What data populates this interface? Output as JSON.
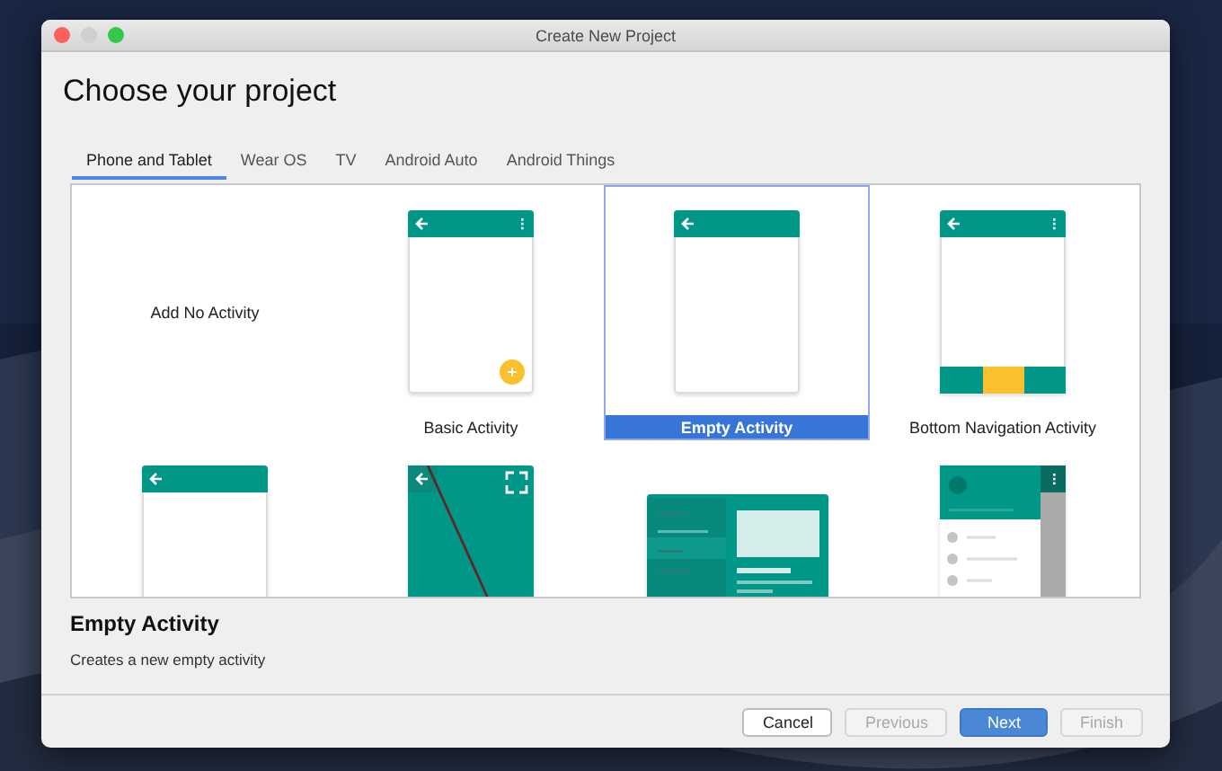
{
  "window": {
    "title": "Create New Project"
  },
  "heading": "Choose your project",
  "tabs": [
    {
      "label": "Phone and Tablet",
      "selected": true
    },
    {
      "label": "Wear OS",
      "selected": false
    },
    {
      "label": "TV",
      "selected": false
    },
    {
      "label": "Android Auto",
      "selected": false
    },
    {
      "label": "Android Things",
      "selected": false
    }
  ],
  "templates": [
    {
      "kind": "none",
      "label": "Add No Activity",
      "selected": false
    },
    {
      "kind": "basic",
      "label": "Basic Activity",
      "selected": false
    },
    {
      "kind": "empty",
      "label": "Empty Activity",
      "selected": true
    },
    {
      "kind": "bottom_nav",
      "label": "Bottom Navigation Activity",
      "selected": false
    },
    {
      "kind": "plain",
      "selected": false
    },
    {
      "kind": "fullscreen",
      "selected": false
    },
    {
      "kind": "master_detail",
      "selected": false
    },
    {
      "kind": "nav_drawer",
      "selected": false
    }
  ],
  "description": {
    "title": "Empty Activity",
    "text": "Creates a new empty activity"
  },
  "buttons": [
    {
      "label": "Cancel",
      "kind": "normal"
    },
    {
      "label": "Previous",
      "kind": "disabled"
    },
    {
      "label": "Next",
      "kind": "default"
    },
    {
      "label": "Finish",
      "kind": "disabled"
    }
  ]
}
